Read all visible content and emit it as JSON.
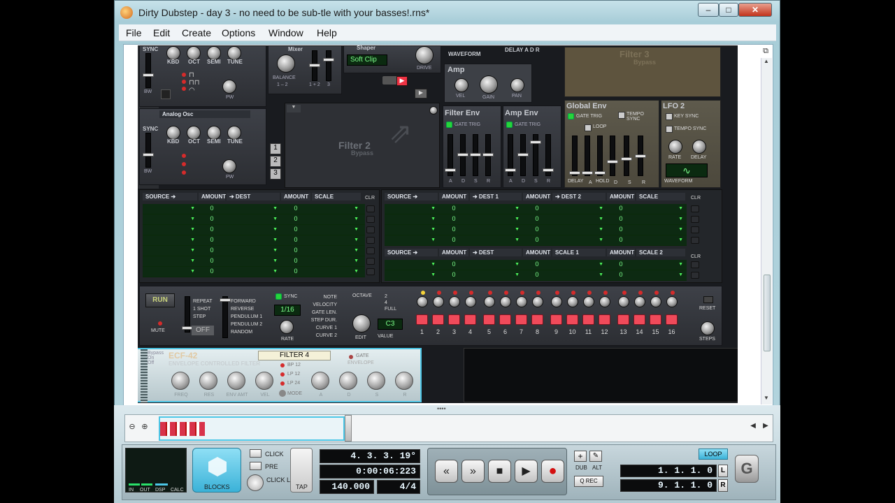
{
  "window": {
    "title": "Dirty Dubstep - day 3 - no need to be sub-tle with your basses!.rns*",
    "min": "–",
    "max": "□",
    "close": "✕"
  },
  "menu": [
    "File",
    "Edit",
    "Create",
    "Options",
    "Window",
    "Help"
  ],
  "osc1": {
    "labels": [
      "KBD",
      "OCT",
      "SEMI",
      "TUNE"
    ],
    "sync": "SYNC",
    "bw": "BW",
    "pw": "PW"
  },
  "osc2": {
    "title": "Analog Osc",
    "labels": [
      "KBD",
      "OCT",
      "SEMI",
      "TUNE"
    ],
    "sync": "SYNC",
    "bw": "BW",
    "pw": "PW"
  },
  "mixer": {
    "title": "Mixer",
    "balance": "BALANCE",
    "b12": "1 – 2",
    "ch": "1 + 2",
    "three": "3"
  },
  "shaper": {
    "title": "Shaper",
    "mode": "Soft Clip",
    "drive": "DRIVE",
    "waveform": "WAVEFORM"
  },
  "delay_adr": "DELAY  A  D  R",
  "amp": {
    "title": "Amp",
    "vel": "VEL",
    "gain": "GAIN",
    "pan": "PAN"
  },
  "filter2": {
    "title": "Filter 2",
    "sub": "Bypass"
  },
  "filter3": {
    "title": "Filter 3",
    "sub": "Bypass"
  },
  "route": [
    "1",
    "2",
    "3"
  ],
  "filter_env": {
    "title": "Filter Env",
    "gate": "GATE TRIG",
    "adsr": [
      "A",
      "D",
      "S",
      "R"
    ]
  },
  "amp_env": {
    "title": "Amp Env",
    "gate": "GATE TRIG",
    "adsr": [
      "A",
      "D",
      "S",
      "R"
    ]
  },
  "global_env": {
    "title": "Global Env",
    "gate": "GATE TRIG",
    "tempo": "TEMPO SYNC",
    "loop": "LOOP",
    "stages": [
      "DELAY",
      "A",
      "HOLD",
      "D",
      "S",
      "R"
    ]
  },
  "lfo2": {
    "title": "LFO 2",
    "key": "KEY SYNC",
    "tempo": "TEMPO SYNC",
    "rate": "RATE",
    "delay": "DELAY",
    "waveform": "WAVEFORM"
  },
  "mod_left": {
    "headers": [
      "SOURCE ➔",
      "AMOUNT",
      "➔ DEST",
      "AMOUNT",
      "SCALE"
    ],
    "rows": 7,
    "value": "0",
    "clr": "CLR"
  },
  "mod_right_top": {
    "headers": [
      "SOURCE ➔",
      "AMOUNT",
      "➔ DEST 1",
      "AMOUNT",
      "➔ DEST 2",
      "AMOUNT",
      "SCALE"
    ],
    "rows": 4,
    "value": "0",
    "clr": "CLR"
  },
  "mod_right_bot": {
    "headers": [
      "SOURCE ➔",
      "AMOUNT",
      "➔ DEST",
      "AMOUNT",
      "SCALE 1",
      "AMOUNT",
      "SCALE 2"
    ],
    "rows": 2,
    "value": "0",
    "clr": "CLR"
  },
  "seq": {
    "run": "RUN",
    "mute": "MUTE",
    "modes1": [
      "REPEAT",
      "1 SHOT",
      "STEP"
    ],
    "off": "OFF",
    "modes2": [
      "FORWARD",
      "REVERSE",
      "PENDULUM 1",
      "PENDULUM 2",
      "RANDOM"
    ],
    "sync": "SYNC",
    "rate_val": "1/16",
    "rate": "RATE",
    "lanes": [
      "NOTE",
      "VELOCITY",
      "GATE LEN.",
      "STEP DUR.",
      "CURVE 1",
      "CURVE 2"
    ],
    "octave": "OCTAVE",
    "oct_opts": [
      "2",
      "4",
      "FULL"
    ],
    "edit": "EDIT",
    "value_disp": "C3",
    "value": "VALUE",
    "steps": [
      "1",
      "2",
      "3",
      "4",
      "5",
      "6",
      "7",
      "8",
      "9",
      "10",
      "11",
      "12",
      "13",
      "14",
      "15",
      "16"
    ],
    "reset": "RESET",
    "steps_lbl": "STEPS"
  },
  "ecf42": {
    "bypass": [
      "Bypass",
      "On",
      "Off"
    ],
    "name": "ECF-42",
    "sub": "ENVELOPE CONTROLLED FILTER",
    "patch": "FILTER 4",
    "gate": "GATE",
    "envelope": "ENVELOPE",
    "modes": [
      "BP 12",
      "LP 12",
      "LP 24"
    ],
    "mode": "MODE",
    "knobs": [
      "FREQ",
      "RES",
      "ENV AMT",
      "VEL",
      "A",
      "D",
      "S",
      "R"
    ]
  },
  "transport": {
    "dsp": [
      "IN",
      "OUT",
      "DSP",
      "CALC"
    ],
    "blocks": "BLOCKS",
    "click": "CLICK",
    "pre": "PRE",
    "click_level": "CLICK LEVEL",
    "tap": "TAP",
    "position": "4.  3.  3.  19°",
    "time": "0:00:06:223",
    "tempo": "140.000",
    "signature": "4/4",
    "dub": "DUB",
    "alt": "ALT",
    "qrec": "Q REC",
    "loop": "LOOP",
    "left": "1.  1.  1.    0",
    "right": "9.  1.  1.    0",
    "l": "L",
    "r": "R",
    "plus": "+",
    "pen": "✎"
  },
  "colors": {
    "accent": "#4cc6e6",
    "lcd_green": "#7cff8a",
    "step_red": "#f04a5a",
    "record": "#d40f0f"
  }
}
